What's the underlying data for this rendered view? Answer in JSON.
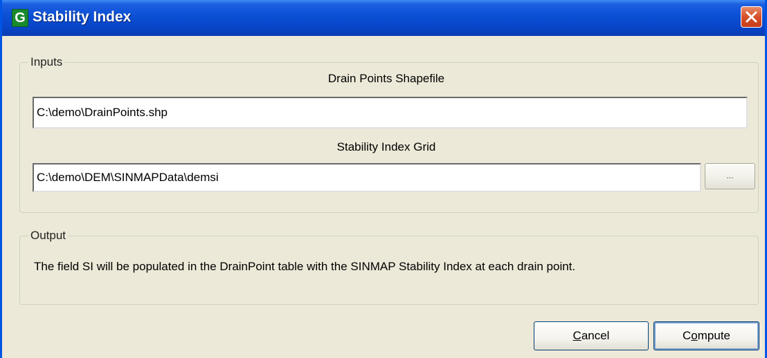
{
  "window": {
    "title": "Stability Index",
    "app_icon_letter": "G"
  },
  "inputs_group": {
    "label": "Inputs",
    "drain_points": {
      "label": "Drain Points Shapefile",
      "value": "C:\\demo\\DrainPoints.shp"
    },
    "stability_grid": {
      "label": "Stability Index Grid",
      "value": "C:\\demo\\DEM\\SINMAPData\\demsi",
      "browse_label": "..."
    }
  },
  "output_group": {
    "label": "Output",
    "description": "The field SI will be populated in the DrainPoint table with the SINMAP Stability Index at each drain point."
  },
  "buttons": {
    "cancel": {
      "mnemonic": "C",
      "rest": "ancel"
    },
    "compute": {
      "pre": "C",
      "mnemonic": "o",
      "rest": "mpute"
    }
  },
  "colors": {
    "title_bar": "#0a4fd4",
    "close_button": "#d8502a",
    "dialog_background": "#ece9d8"
  }
}
